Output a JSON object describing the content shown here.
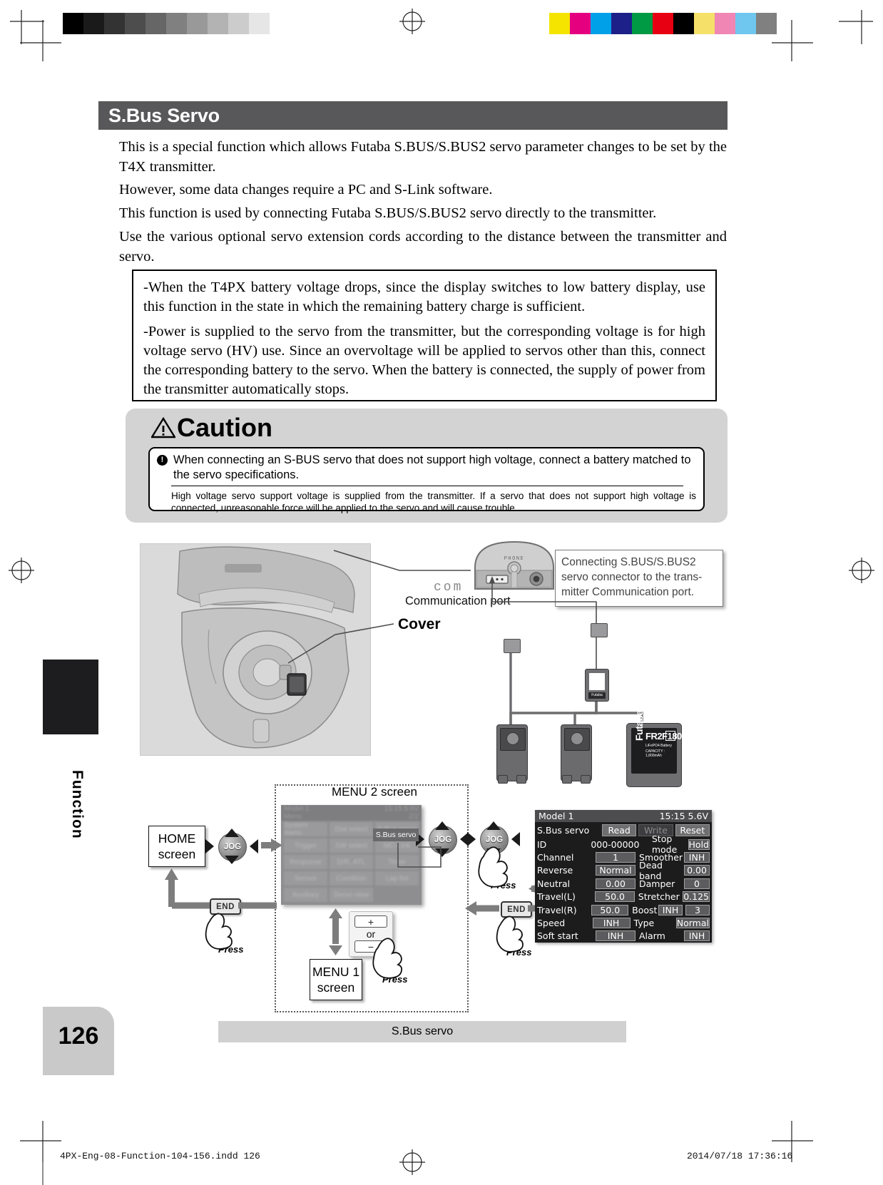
{
  "page": {
    "number": "126",
    "side_tab_label": "Function",
    "footer_caption": "S.Bus servo",
    "imprint_left": "4PX-Eng-08-Function-104-156.indd   126",
    "imprint_right": "2014/07/18   17:36:16"
  },
  "section": {
    "title": "S.Bus Servo",
    "paragraphs": [
      "This is a special function which allows Futaba S.BUS/S.BUS2 servo parameter changes to be set by the T4X transmitter.",
      "However, some data changes require a PC and S-Link software.",
      "This function is used by connecting Futaba S.BUS/S.BUS2 servo directly to the transmitter.",
      "Use the various optional servo extension cords according to the distance between the transmitter and servo."
    ]
  },
  "note_box": {
    "items": [
      "-When the T4PX battery voltage drops, since the display switches to low battery display, use this function in the state in which the remaining battery charge is sufficient.",
      "-Power is supplied to the servo from the transmitter, but the corresponding voltage is for high voltage servo (HV) use. Since an overvoltage will be applied to servos other than this, connect the corresponding battery to the servo. When the battery is connected, the supply of power from the transmitter automatically stops."
    ]
  },
  "caution": {
    "heading": "Caution",
    "warning_icon": "warning-triangle-icon",
    "bullet_marker": "!",
    "bullet_text": "When connecting an S-BUS servo that does not support high voltage, connect a battery matched to the servo specifications.",
    "detail_text": "High voltage servo support voltage is supplied from the transmitter. If a servo that does not support high voltage is connected, unreasonable force will be applied to the servo and will cause trouble."
  },
  "diagram": {
    "callout": "Connecting S.BUS/S.BUS2 servo connector to the trans-mitter Communication port.",
    "com_word": "com",
    "communication_port_label": "Communication port",
    "cover_label": "Cover",
    "phone_label": "PHONE",
    "battery_brand": "Futaba",
    "battery_model": "FR2F1800",
    "battery_spec1": "LiFePO4 Battery",
    "battery_spec2": "CAPACITY : 1,800mAh",
    "hub_label": "Futaba"
  },
  "flow": {
    "home_screen": [
      "HOME",
      "screen"
    ],
    "menu1_screen": [
      "MENU 1",
      "screen"
    ],
    "menu2_caption": "MENU 2 screen",
    "jog_label": "JOG",
    "end_label": "END",
    "press_label": "Press",
    "plus_label": "+",
    "minus_label": "−",
    "or_label": "or",
    "menu2_items": [
      [
        "System menu",
        "Dial select",
        "S.Bus servo"
      ],
      [
        "Trigger",
        "SW select",
        "MC-Link"
      ],
      [
        "Response",
        "D/R, ATL",
        "Timer"
      ],
      [
        "Sensor",
        "Condition",
        "Lap list"
      ],
      [
        "Auxiliary",
        "Servo view",
        ""
      ]
    ],
    "menu2_page": "2/2",
    "menu2_title": "Model 1",
    "menu2_sub": "Menu",
    "menu2_time": "15:15 5.6V",
    "highlight_item": "S.Bus servo"
  },
  "lcd": {
    "model": "Model 1",
    "time_volt": "15:15 5.6V",
    "screen_name": "S.Bus servo",
    "buttons": [
      {
        "label": "Read",
        "state": "active"
      },
      {
        "label": "Write",
        "state": "dim"
      },
      {
        "label": "Reset",
        "state": "active"
      }
    ],
    "rows": [
      {
        "label": "ID",
        "value": "000-00000",
        "label2": "Stop mode",
        "value2": "Hold"
      },
      {
        "label": "Channel",
        "value": "1",
        "label2": "Smoother",
        "value2": "INH"
      },
      {
        "label": "Reverse",
        "value": "Normal",
        "label2": "Dead band",
        "value2": "0.00"
      },
      {
        "label": "Neutral",
        "value": "0.00",
        "label2": "Damper",
        "value2": "0"
      },
      {
        "label": "Travel(L)",
        "value": "50.0",
        "label2": "Stretcher",
        "value2": "0.125"
      },
      {
        "label": "Travel(R)",
        "value": "50.0",
        "label2": "Boost",
        "value2a": "INH",
        "value2": "3"
      },
      {
        "label": "Speed",
        "value": "INH",
        "label2": "Type",
        "value2": "Normal"
      },
      {
        "label": "Soft start",
        "value": "INH",
        "label2": "Alarm",
        "value2": "INH"
      }
    ]
  },
  "print_marks": {
    "gray_swatches": [
      "#000000",
      "#1a1a1a",
      "#333333",
      "#4d4d4d",
      "#666666",
      "#808080",
      "#999999",
      "#b3b3b3",
      "#cccccc",
      "#e6e6e6",
      "#ffffff"
    ],
    "color_swatches": [
      "#f5e400",
      "#e5007f",
      "#00a0e9",
      "#1d2088",
      "#009944",
      "#e60012",
      "#000000",
      "#f5e06a",
      "#ef86b4",
      "#6fc7ef",
      "#808080"
    ]
  }
}
